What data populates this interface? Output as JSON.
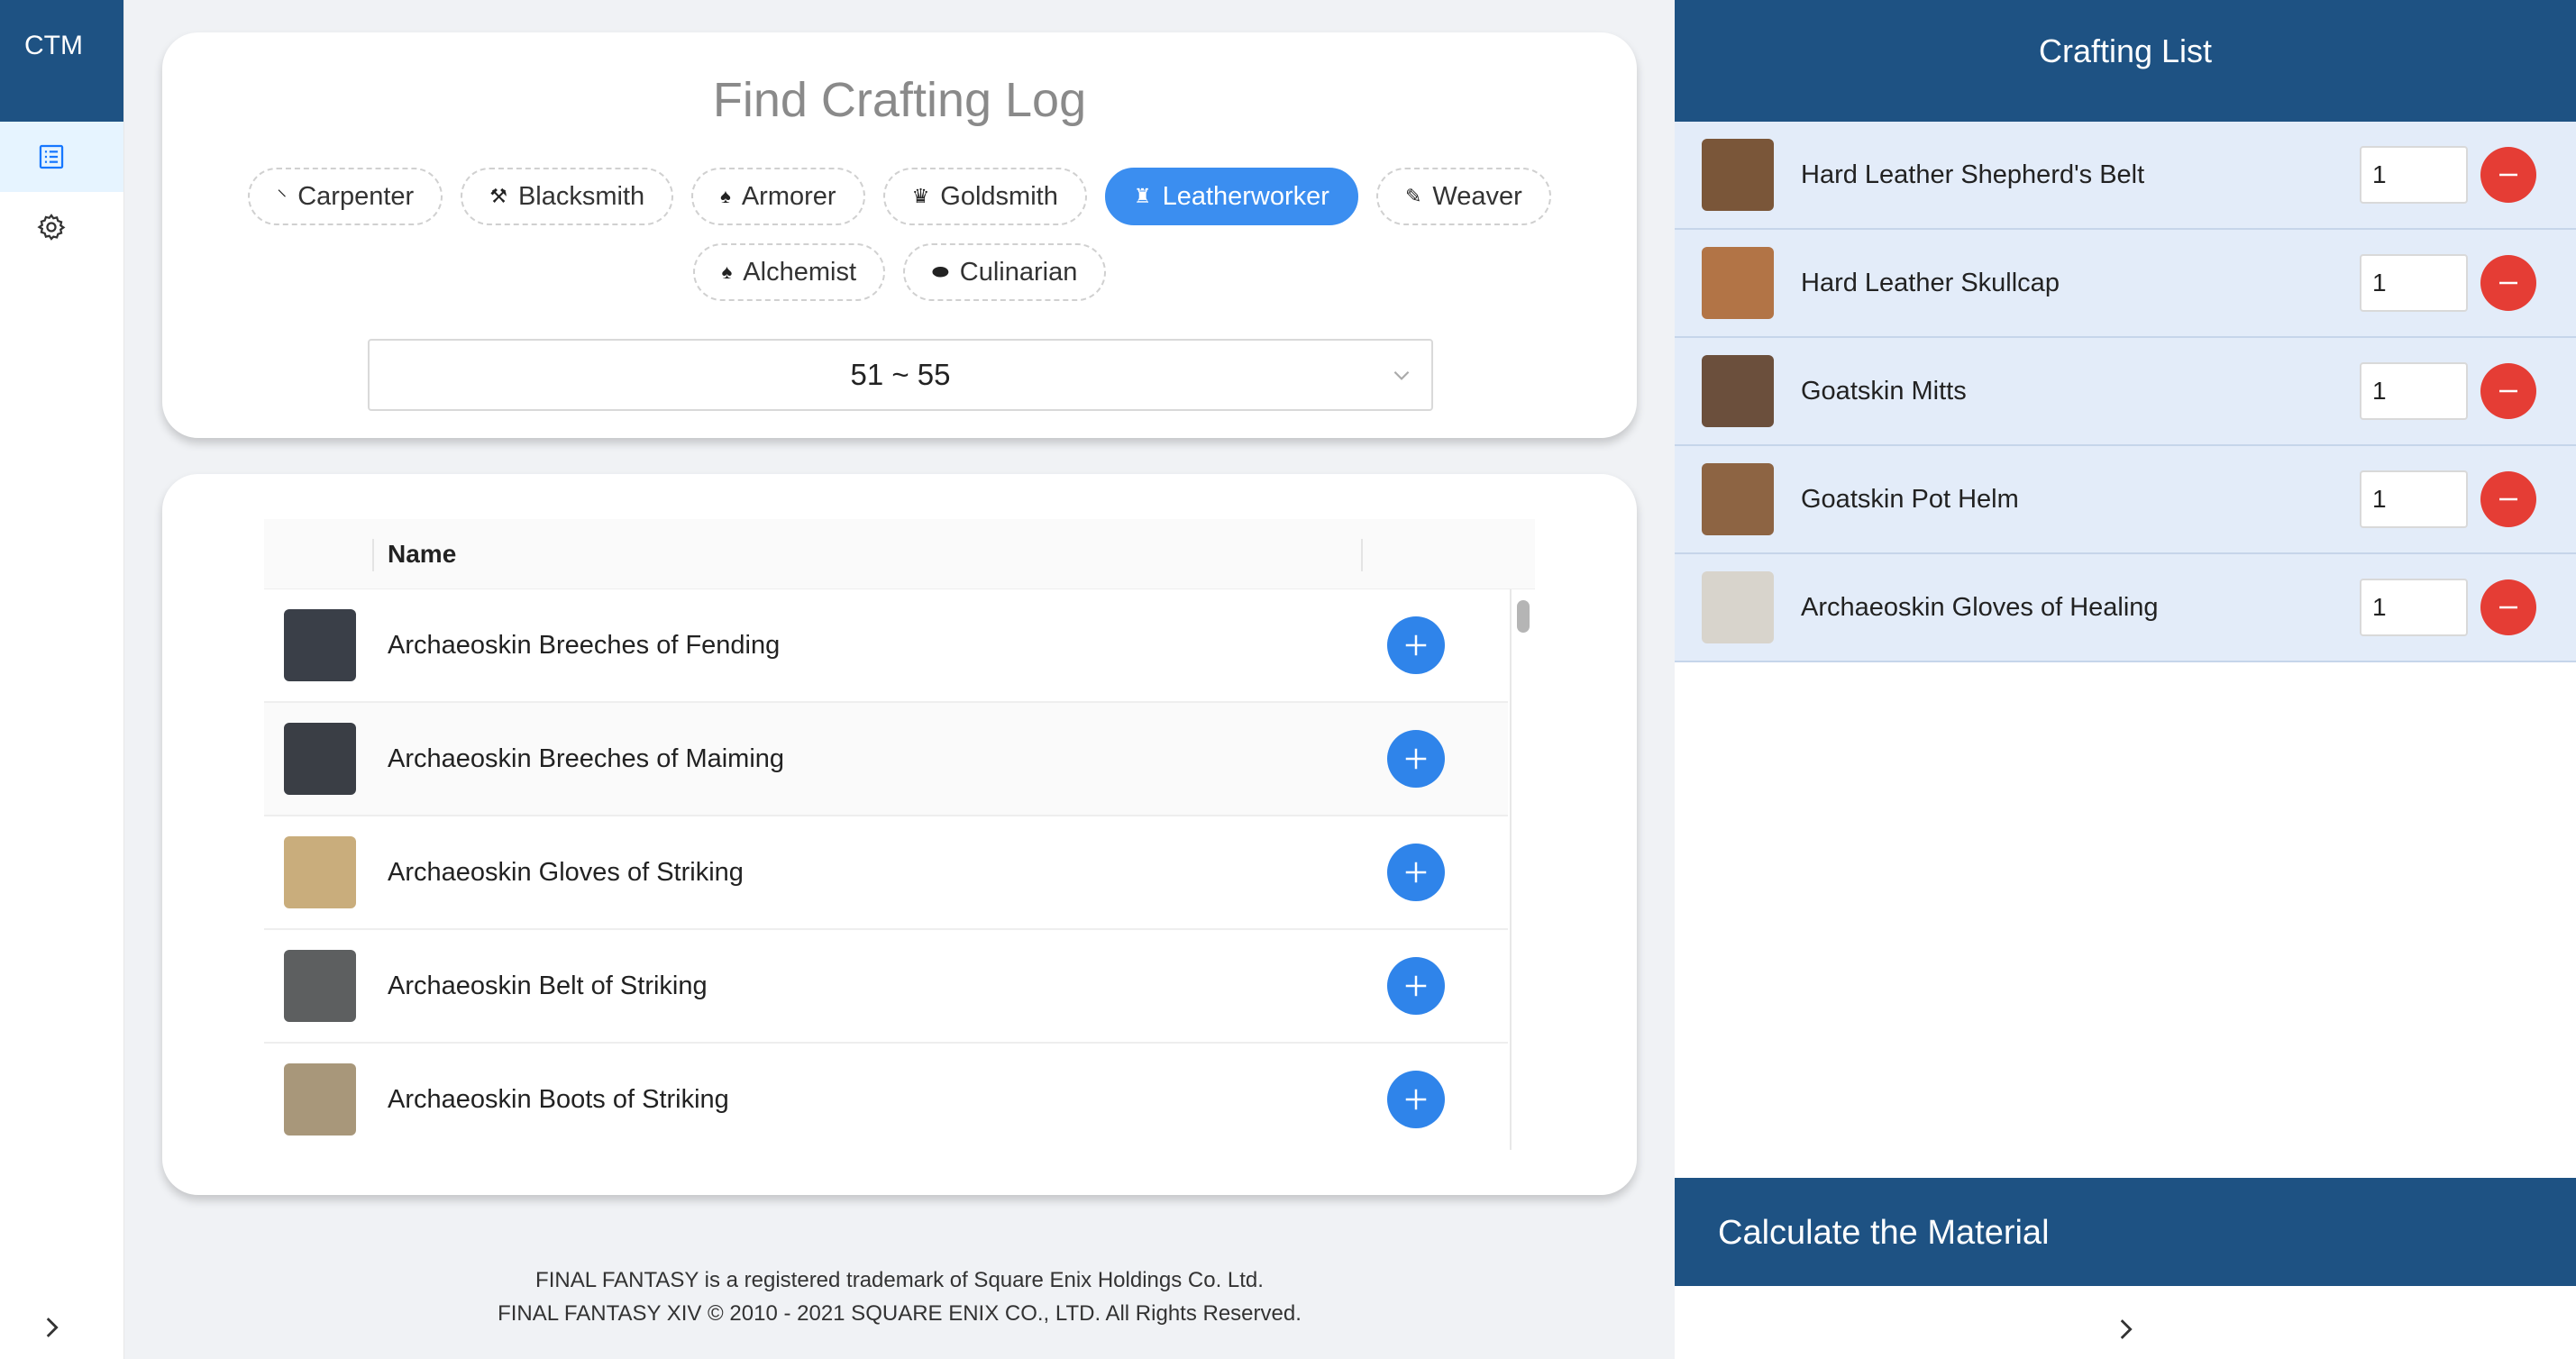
{
  "sidebar": {
    "logo": "CTM",
    "items": [
      {
        "icon": "list-icon",
        "active": true
      },
      {
        "icon": "gear-icon",
        "active": false
      }
    ],
    "collapse_icon": "chevron-right-icon"
  },
  "search": {
    "title": "Find Crafting Log",
    "classes_row1": [
      {
        "label": "Carpenter",
        "icon": "⸌",
        "active": false
      },
      {
        "label": "Blacksmith",
        "icon": "⚒",
        "active": false
      },
      {
        "label": "Armorer",
        "icon": "♠",
        "active": false
      },
      {
        "label": "Goldsmith",
        "icon": "♛",
        "active": false
      },
      {
        "label": "Leatherworker",
        "icon": "♜",
        "active": true
      },
      {
        "label": "Weaver",
        "icon": "✎",
        "active": false
      }
    ],
    "classes_row2": [
      {
        "label": "Alchemist",
        "icon": "♠",
        "active": false
      },
      {
        "label": "Culinarian",
        "icon": "⬬",
        "active": false
      }
    ],
    "level_range": "51 ~ 55"
  },
  "table": {
    "header_name": "Name",
    "rows": [
      {
        "name": "Archaeoskin Breeches of Fending",
        "thumb_color": "#3a3f48"
      },
      {
        "name": "Archaeoskin Breeches of Maiming",
        "thumb_color": "#3a3e45"
      },
      {
        "name": "Archaeoskin Gloves of Striking",
        "thumb_color": "#c9ad7c"
      },
      {
        "name": "Archaeoskin Belt of Striking",
        "thumb_color": "#5d5f60"
      },
      {
        "name": "Archaeoskin Boots of Striking",
        "thumb_color": "#a8977a"
      }
    ]
  },
  "footer": {
    "line1": "FINAL FANTASY is a registered trademark of Square Enix Holdings Co. Ltd.",
    "line2": "FINAL FANTASY XIV © 2010 - 2021 SQUARE ENIX CO., LTD. All Rights Reserved."
  },
  "crafting_list": {
    "title": "Crafting List",
    "items": [
      {
        "name": "Hard Leather Shepherd's Belt",
        "qty": "1",
        "thumb_color": "#7a5639"
      },
      {
        "name": "Hard Leather Skullcap",
        "qty": "1",
        "thumb_color": "#b27446"
      },
      {
        "name": "Goatskin Mitts",
        "qty": "1",
        "thumb_color": "#6b4f3c"
      },
      {
        "name": "Goatskin Pot Helm",
        "qty": "1",
        "thumb_color": "#8d6443"
      },
      {
        "name": "Archaeoskin Gloves of Healing",
        "qty": "1",
        "thumb_color": "#d8d4cc"
      }
    ],
    "calculate_label": "Calculate the Material"
  },
  "colors": {
    "primary_dark": "#1e5283",
    "accent_blue": "#3b8ef0",
    "danger_red": "#e53d35"
  }
}
